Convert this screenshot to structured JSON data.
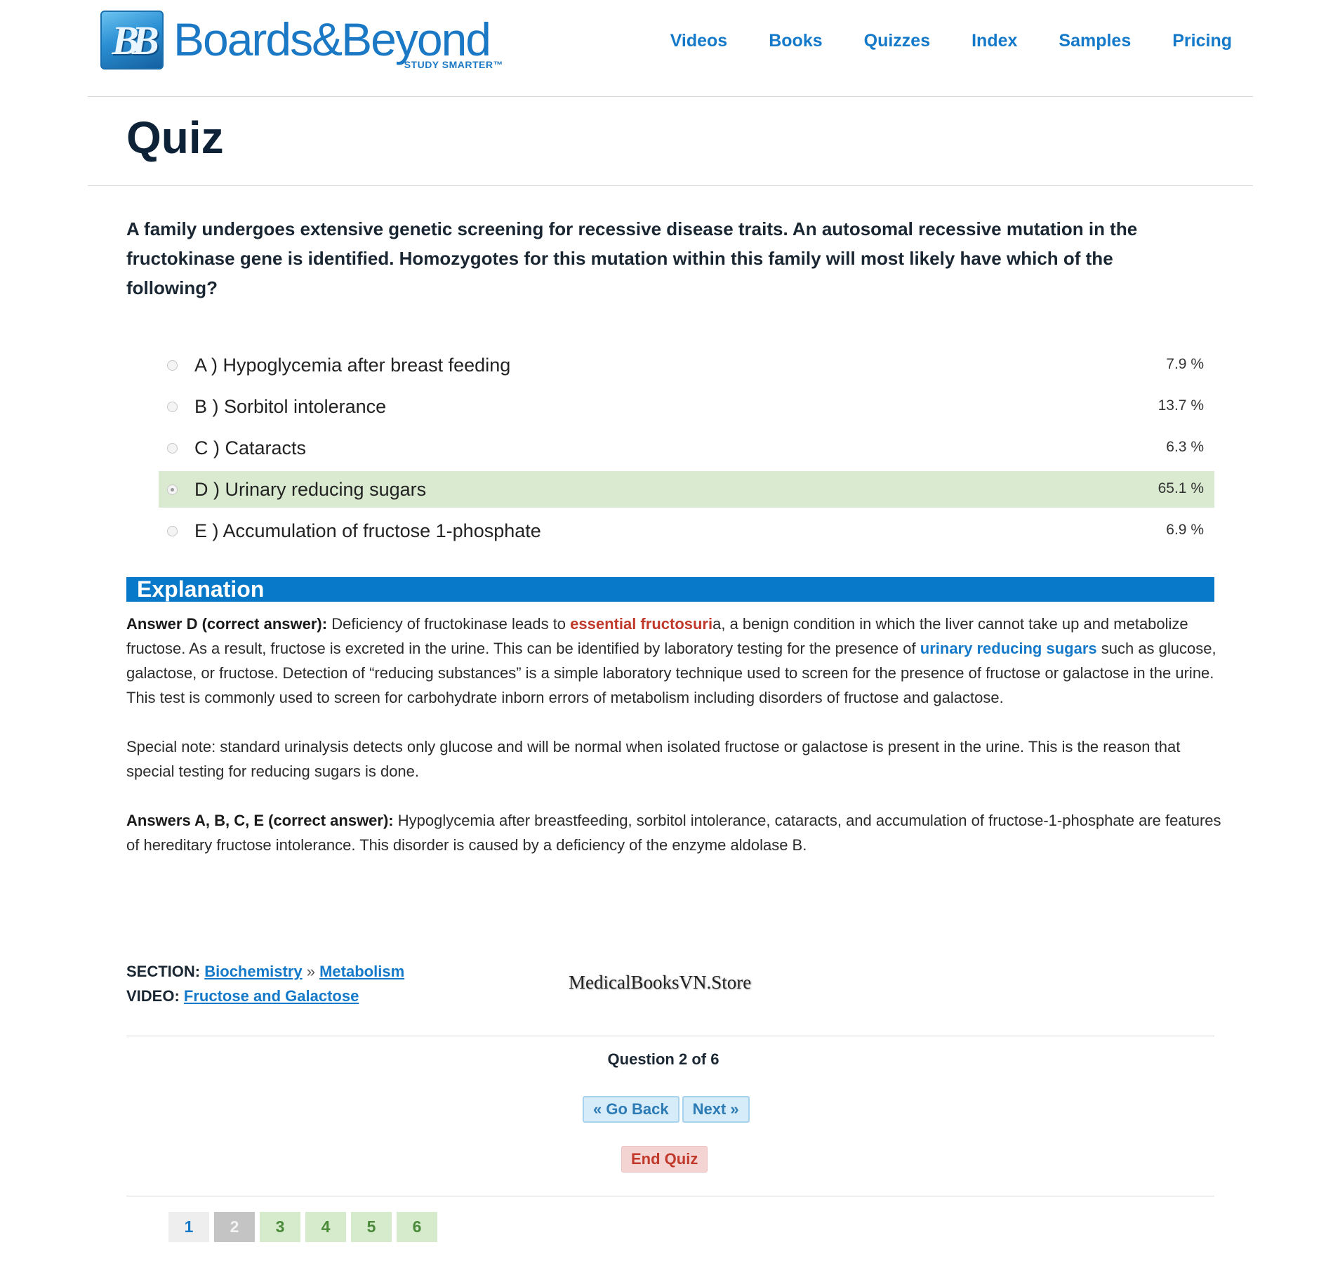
{
  "header": {
    "logo_mark": "BB",
    "logo_name": "Boards&Beyond",
    "logo_tagline": "STUDY SMARTER™",
    "nav": [
      "Videos",
      "Books",
      "Quizzes",
      "Index",
      "Samples",
      "Pricing"
    ]
  },
  "page_title": "Quiz",
  "question": "A family undergoes extensive genetic screening for recessive disease traits. An autosomal recessive mutation in the fructokinase gene is identified. Homozygotes for this mutation within this family will most likely have which of the following?",
  "answers": [
    {
      "label": "A ) Hypoglycemia after breast feeding",
      "percent": "7.9 %"
    },
    {
      "label": "B ) Sorbitol intolerance",
      "percent": "13.7 %"
    },
    {
      "label": "C ) Cataracts",
      "percent": "6.3 %"
    },
    {
      "label": "D ) Urinary reducing sugars",
      "percent": "65.1 %"
    },
    {
      "label": "E ) Accumulation of fructose 1-phosphate",
      "percent": "6.9 %"
    }
  ],
  "selected_answer": "D",
  "explanation": {
    "heading": "Explanation",
    "p1_lead": "Answer D (correct answer):",
    "p1_a": " Deficiency of fructokinase leads to ",
    "p1_red": "essential fructosuri",
    "p1_b": "a, a benign condition in which the liver cannot take up and metabolize fructose. As a result, fructose is excreted in the urine. This can be identified by laboratory testing for the presence of ",
    "p1_blue": "urinary reducing sugars",
    "p1_c": " such as glucose, galactose, or fructose.  Detection of “reducing substances” is a simple laboratory technique used to screen for the presence of fructose or galactose in the urine. This test is commonly used to screen for carbohydrate inborn errors of metabolism including disorders of fructose and galactose.",
    "p2": "Special note: standard urinalysis detects only glucose and will be normal when isolated fructose or galactose is present in the urine. This is the reason that special testing for reducing sugars is done.",
    "p3_lead": "Answers A, B, C, E (correct answer):",
    "p3_text": " Hypoglycemia after breastfeeding, sorbitol intolerance, cataracts, and accumulation of fructose-1-phosphate are features of hereditary fructose intolerance. This disorder is caused by a deficiency of the enzyme aldolase B."
  },
  "section": {
    "section_label": "SECTION:",
    "subject": "Biochemistry",
    "separator": " » ",
    "topic": "Metabolism",
    "video_label": "VIDEO:",
    "video": "Fructose and Galactose"
  },
  "watermark": "MedicalBooksVN.Store",
  "nav_footer": {
    "question_count": "Question 2 of 6",
    "go_back": "« Go Back",
    "next": "Next »",
    "end_quiz": "End Quiz",
    "pages": [
      "1",
      "2",
      "3",
      "4",
      "5",
      "6"
    ]
  },
  "colors": {
    "accent_blue": "#1479c9",
    "explanation_bar": "#0879c9",
    "selected_row": "#d9ead0",
    "highlight_red": "#c0392b"
  }
}
